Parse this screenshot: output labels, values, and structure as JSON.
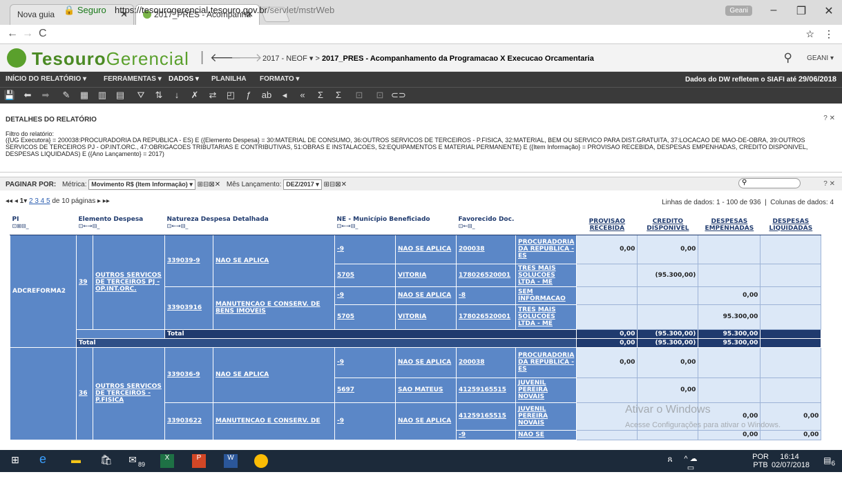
{
  "browser": {
    "tab1": "Nova guia",
    "tab2": "2017_PRES - Acompanha",
    "user": "Geani",
    "secure": "Seguro",
    "url_host": "https://tesourogerencial.tesouro.gov.br",
    "url_path": "/servlet/mstrWeb"
  },
  "app": {
    "brand_bold": "Tesouro",
    "brand_light": "Gerencial",
    "breadcrumb_root": "2017 - NEOF",
    "breadcrumb_page": "2017_PRES - Acompanhamento da Programacao X Execucao Orcamentaria",
    "user_menu": "GEANI"
  },
  "menu": {
    "inicio": "INÍCIO DO RELATÓRIO",
    "ferramentas": "FERRAMENTAS",
    "dados": "DADOS",
    "planilha": "PLANILHA",
    "formato": "FORMATO",
    "dw_prefix": "Dados do DW refletem o SIAFI até",
    "dw_date": "29/06/2018"
  },
  "details": {
    "title": "DETALHES DO RELATÓRIO",
    "filter_label": "Filtro do relatório:",
    "filter_text": "({UG Executora} = 200038:PROCURADORIA DA REPUBLICA - ES) E ({Elemento Despesa} = 30:MATERIAL DE CONSUMO, 36:OUTROS SERVICOS DE TERCEIROS - P.FISICA, 32:MATERIAL, BEM OU SERVICO PARA DIST.GRATUITA, 37:LOCACAO DE MAO-DE-OBRA, 39:OUTROS SERVICOS DE TERCEIROS PJ - OP.INT.ORC., 47:OBRIGACOES TRIBUTARIAS E CONTRIBUTIVAS, 51:OBRAS E INSTALACOES, 52:EQUIPAMENTOS E MATERIAL PERMANENTE) E ({Item Informação} = PROVISAO RECEBIDA, DESPESAS EMPENHADAS, CREDITO DISPONIVEL, DESPESAS LIQUIDADAS) E ({Ano Lançamento} = 2017)"
  },
  "paging": {
    "label": "PAGINAR POR:",
    "metric_label": "Métrica:",
    "metric_value": "Movimento R$ (Item Informação)",
    "month_label": "Mês Lançamento:",
    "month_value": "DEZ/2017",
    "pages": "1",
    "page_links": "2 3 4 5",
    "of_pages": "de 10 páginas",
    "rows_info": "Linhas de dados: 1 - 100 de 936",
    "cols_info": "Colunas de dados: 4"
  },
  "grid": {
    "headers": {
      "pi": "PI",
      "elemento": "Elemento Despesa",
      "natureza": "Natureza Despesa Detalhada",
      "ne": "NE - Município Beneficiado",
      "favorecido": "Favorecido Doc.",
      "provisao": "PROVISAO RECEBIDA",
      "credito": "CREDITO DISPONIVEL",
      "empenhadas": "DESPESAS EMPENHADAS",
      "liquidadas": "DESPESAS LIQUIDADAS"
    },
    "pi1": "ADCREFORMA2",
    "el39_code": "39",
    "el39_name": "OUTROS SERVICOS DE TERCEIROS PJ - OP.INT.ORC.",
    "nat_339039": "339039-9",
    "nat_nsa": "NAO SE APLICA",
    "nat_33903916": "33903916",
    "nat_manut": "MANUTENCAO E CONSERV. DE BENS IMOVEIS",
    "neg": "-9",
    "mun_nsa": "NAO SE APLICA",
    "n5705": "5705",
    "vitoria": "VITORIA",
    "fav200038": "200038",
    "procuradoria": "PROCURADORIA DA REPUBLICA - ES",
    "fav1780": "178026520001",
    "tres": "TRES MAIS SOLUCOES LTDA - ME",
    "neg8": "-8",
    "seminf": "SEM INFORMACAO",
    "v000": "0,00",
    "vneg": "(95.300,00)",
    "vpos": "95.300,00",
    "total": "Total",
    "el36_code": "36",
    "el36_name": "OUTROS SERVICOS DE TERCEIROS - P.FISICA",
    "nat_339036": "339036-9",
    "n5697": "5697",
    "saomateus": "SAO MATEUS",
    "fav4125": "41259165515",
    "juvenil": "JUVENIL PEREIRA NOVAIS",
    "nat_339036_22": "33903622",
    "nat_manut2": "MANUTENCAO E CONSERV. DE",
    "naose": "NAO SE"
  },
  "watermark": {
    "line1": "Ativar o Windows",
    "line2": "Acesse Configurações para ativar o Windows."
  },
  "tray": {
    "lang1": "POR",
    "lang2": "PTB",
    "time": "16:14",
    "date": "02/07/2018",
    "badge": "6",
    "store_badge": "89"
  }
}
